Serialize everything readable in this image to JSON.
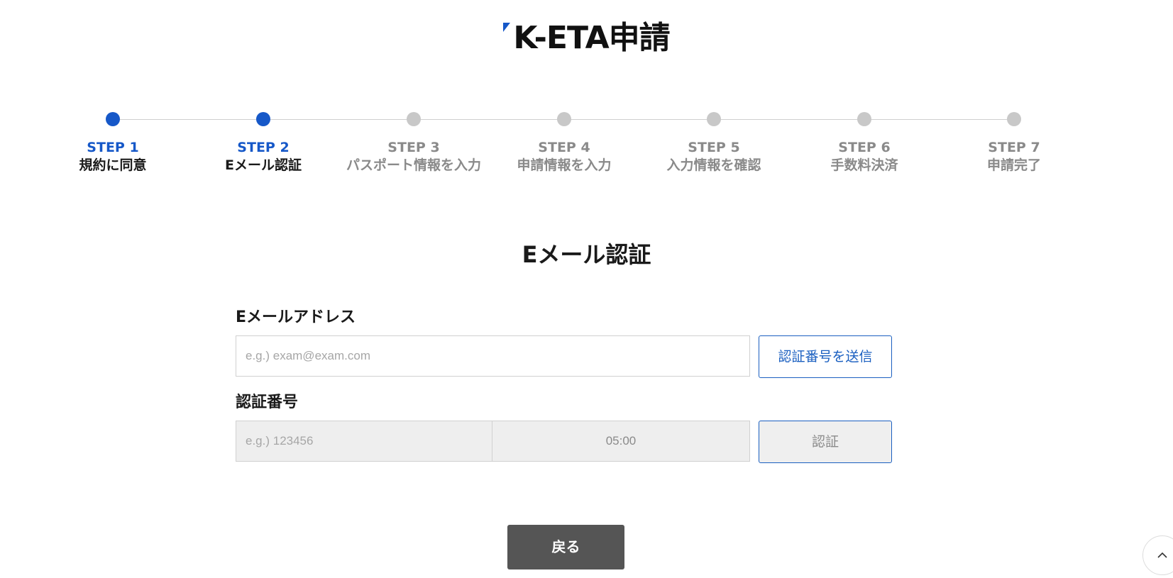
{
  "header": {
    "logo_text": "K-ETA申請",
    "accent_color": "#1658c8"
  },
  "stepper": {
    "steps": [
      {
        "num": "STEP 1",
        "label": "規約に同意",
        "active": true
      },
      {
        "num": "STEP 2",
        "label": "Eメール認証",
        "active": true
      },
      {
        "num": "STEP 3",
        "label": "パスポート情報を入力",
        "active": false
      },
      {
        "num": "STEP 4",
        "label": "申請情報を入力",
        "active": false
      },
      {
        "num": "STEP 5",
        "label": "入力情報を確認",
        "active": false
      },
      {
        "num": "STEP 6",
        "label": "手数料決済",
        "active": false
      },
      {
        "num": "STEP 7",
        "label": "申請完了",
        "active": false
      }
    ]
  },
  "main": {
    "title": "Eメール認証",
    "email": {
      "label": "Eメールアドレス",
      "placeholder": "e.g.) exam@exam.com",
      "send_button": "認証番号を送信"
    },
    "code": {
      "label": "認証番号",
      "placeholder": "e.g.) 123456",
      "timer": "05:00",
      "verify_button": "認証"
    },
    "back_button": "戻る"
  },
  "icons": {
    "scroll_top": "chevron-up-icon"
  }
}
